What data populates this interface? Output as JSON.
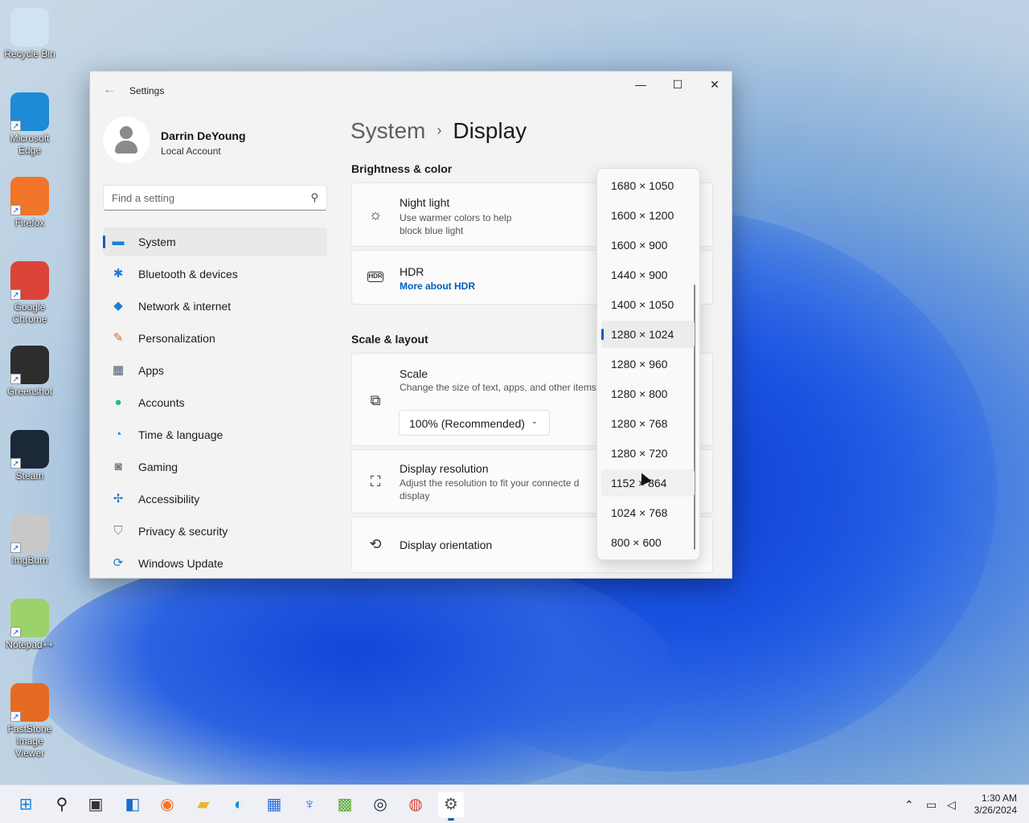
{
  "desktop": {
    "icons": [
      {
        "label": "Recycle Bin",
        "icon": "recycle-bin-icon",
        "color": "#cfe3f5"
      },
      {
        "label": "Microsoft\nEdge",
        "icon": "edge-icon",
        "color": "#1d8bd8"
      },
      {
        "label": "Firefox",
        "icon": "firefox-icon",
        "color": "#f0742a"
      },
      {
        "label": "Google\nChrome",
        "icon": "chrome-icon",
        "color": "#db4437"
      },
      {
        "label": "Greenshot",
        "icon": "greenshot-icon",
        "color": "#2d2d2d"
      },
      {
        "label": "Steam",
        "icon": "steam-icon",
        "color": "#1b2838"
      },
      {
        "label": "ImgBurn",
        "icon": "imgburn-icon",
        "color": "#c8c8c8"
      },
      {
        "label": "Notepad++",
        "icon": "notepadpp-icon",
        "color": "#9bd26c"
      },
      {
        "label": "FastStone\nImage Viewer",
        "icon": "faststone-icon",
        "color": "#e56a22"
      }
    ],
    "shortcut_arrow": "↗"
  },
  "window": {
    "title": "Settings",
    "back_glyph": "←",
    "minimize_glyph": "—",
    "maximize_glyph": "☐",
    "close_glyph": "✕"
  },
  "profile": {
    "name": "Darrin DeYoung",
    "account_type": "Local Account"
  },
  "search": {
    "placeholder": "Find a setting",
    "value": "",
    "icon_glyph": "⚲"
  },
  "nav": {
    "items": [
      {
        "label": "System",
        "icon": "monitor-icon",
        "glyph": "▬",
        "color": "#1a7fd6",
        "active": true
      },
      {
        "label": "Bluetooth & devices",
        "icon": "bluetooth-icon",
        "glyph": "✱",
        "color": "#1a7fd6",
        "active": false
      },
      {
        "label": "Network & internet",
        "icon": "wifi-icon",
        "glyph": "◆",
        "color": "#1a7fd6",
        "active": false
      },
      {
        "label": "Personalization",
        "icon": "brush-icon",
        "glyph": "✎",
        "color": "#c76b2a",
        "active": false
      },
      {
        "label": "Apps",
        "icon": "apps-icon",
        "glyph": "▦",
        "color": "#4a5a78",
        "active": false
      },
      {
        "label": "Accounts",
        "icon": "accounts-icon",
        "glyph": "●",
        "color": "#2bb57a",
        "active": false
      },
      {
        "label": "Time & language",
        "icon": "globe-clock-icon",
        "glyph": "◔",
        "color": "#1a7fd6",
        "active": false
      },
      {
        "label": "Gaming",
        "icon": "gamepad-icon",
        "glyph": "◙",
        "color": "#777777",
        "active": false
      },
      {
        "label": "Accessibility",
        "icon": "accessibility-icon",
        "glyph": "✢",
        "color": "#1a6fc6",
        "active": false
      },
      {
        "label": "Privacy & security",
        "icon": "shield-icon",
        "glyph": "⛉",
        "color": "#888888",
        "active": false
      },
      {
        "label": "Windows Update",
        "icon": "update-icon",
        "glyph": "⟳",
        "color": "#1a7fd6",
        "active": false
      }
    ]
  },
  "breadcrumb": {
    "parent": "System",
    "separator": "›",
    "current": "Display"
  },
  "sections": {
    "brightness": "Brightness & color",
    "scale_layout": "Scale & layout"
  },
  "cards": {
    "night_light": {
      "title": "Night light",
      "desc": "Use warmer colors to help block blue light",
      "glyph": "☼"
    },
    "hdr": {
      "title": "HDR",
      "link": "More about HDR",
      "glyph": "HDR"
    },
    "scale": {
      "title": "Scale",
      "desc": "Change the size of text, apps, and other items",
      "value": "100% (Recommended)",
      "chevron": "⌄",
      "glyph": "⧉"
    },
    "resolution": {
      "title": "Display resolution",
      "desc": "Adjust the resolution to fit your connecte d display",
      "glyph": "⛶"
    },
    "orientation": {
      "title": "Display orientation",
      "glyph": "⟲"
    }
  },
  "resolution_dropdown": {
    "options": [
      "1680 × 1050",
      "1600 × 1200",
      "1600 × 900",
      "1440 × 900",
      "1400 × 1050",
      "1280 × 1024",
      "1280 × 960",
      "1280 × 800",
      "1280 × 768",
      "1280 × 720",
      "1152 × 864",
      "1024 × 768",
      "800 × 600"
    ],
    "selected_index": 5,
    "hover_index": 10
  },
  "taskbar": {
    "items": [
      {
        "name": "start-button",
        "glyph": "⊞",
        "color": "#1a7fd6"
      },
      {
        "name": "search-taskbar-button",
        "glyph": "⚲",
        "color": "#222222"
      },
      {
        "name": "task-view-button",
        "glyph": "▣",
        "color": "#333333"
      },
      {
        "name": "widgets-button",
        "glyph": "◧",
        "color": "#1a6fc6"
      },
      {
        "name": "firefox-taskbar-button",
        "glyph": "◉",
        "color": "#f0742a"
      },
      {
        "name": "file-explorer-button",
        "glyph": "▰",
        "color": "#e8b730"
      },
      {
        "name": "edge-taskbar-button",
        "glyph": "◐",
        "color": "#1d8bd8"
      },
      {
        "name": "store-button",
        "glyph": "▦",
        "color": "#2a6fd6"
      },
      {
        "name": "feather-app-button",
        "glyph": "♆",
        "color": "#3a6fd6"
      },
      {
        "name": "greenshot-taskbar-button",
        "glyph": "▩",
        "color": "#55aa33"
      },
      {
        "name": "steam-taskbar-button",
        "glyph": "◎",
        "color": "#1b2838"
      },
      {
        "name": "chrome-taskbar-button",
        "glyph": "◍",
        "color": "#db4437"
      },
      {
        "name": "settings-taskbar-button",
        "glyph": "⚙",
        "color": "#555555",
        "active": true
      }
    ],
    "tray": {
      "chevron": "⌃",
      "network": "▭",
      "volume": "◁"
    },
    "time": "1:30 AM",
    "date": "3/26/2024"
  }
}
